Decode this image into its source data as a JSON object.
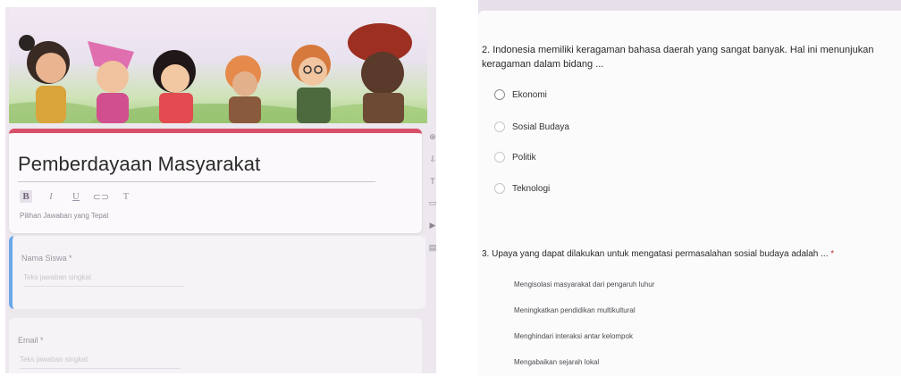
{
  "form": {
    "title": "Pemberdayaan Masyarakat",
    "description": "Pilihan Jawaban yang Tepat",
    "toolbar": {
      "bold": "B",
      "italic": "I",
      "underline": "U",
      "link": "⊂⊃",
      "clear": "T"
    },
    "side_tools": [
      "⊕",
      "⇩",
      "T",
      "▭",
      "▶",
      "▤"
    ],
    "questions": [
      {
        "label": "Nama Siswa *",
        "hint": "Teks jawaban singkat"
      },
      {
        "label": "Email *",
        "hint": "Teks jawaban singkat"
      }
    ]
  },
  "quiz": {
    "q2": {
      "line1": "2. Indonesia memiliki keragaman bahasa daerah yang sangat banyak. Hal ini menunjukan",
      "line2": "keragaman dalam bidang ...",
      "options": [
        "Ekonomi",
        "Sosial Budaya",
        "Politik",
        "Teknologi"
      ]
    },
    "q3": {
      "text": "3. Upaya yang dapat dilakukan untuk mengatasi permasalahan sosial budaya adalah ...",
      "required": "*",
      "options": [
        "Mengisolasi masyarakat dari pengaruh luhur",
        "Meningkatkan pendidikan multikultural",
        "Menghindari interaksi antar kelompok",
        "Mengabaikan sejarah lokal"
      ]
    }
  },
  "colors": {
    "accent": "#d9506a",
    "focus": "#6aa7e8",
    "required": "#c8303a"
  }
}
